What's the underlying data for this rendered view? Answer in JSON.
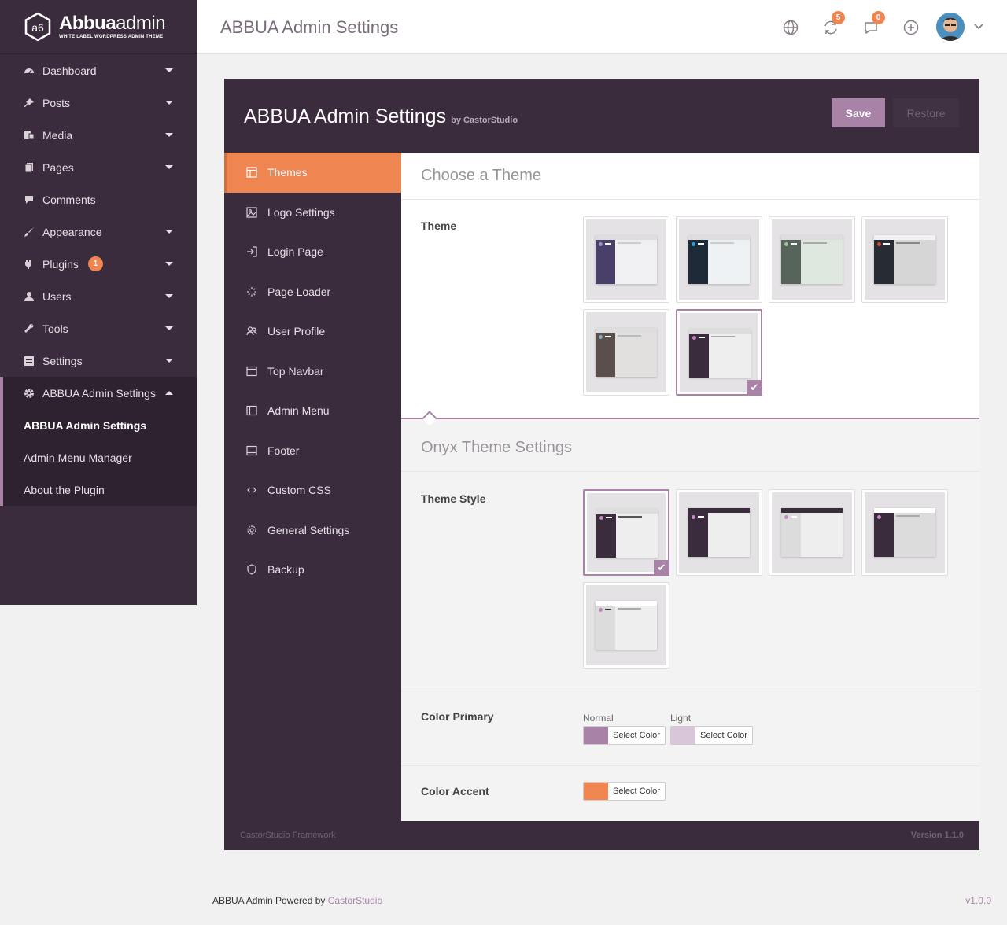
{
  "app": {
    "logo_name_bold": "Abbua",
    "logo_name_light": "admin",
    "logo_tagline": "WHITE LABEL WORDPRESS ADMIN THEME",
    "logo_glyph": "a6"
  },
  "sidebar": {
    "items": [
      {
        "label": "Dashboard",
        "icon": "dashboard-icon"
      },
      {
        "label": "Posts",
        "icon": "pin-icon"
      },
      {
        "label": "Media",
        "icon": "media-icon"
      },
      {
        "label": "Pages",
        "icon": "pages-icon"
      },
      {
        "label": "Comments",
        "icon": "comment-icon"
      },
      {
        "label": "Appearance",
        "icon": "brush-icon"
      },
      {
        "label": "Plugins",
        "icon": "plugin-icon",
        "badge": "1"
      },
      {
        "label": "Users",
        "icon": "user-icon"
      },
      {
        "label": "Tools",
        "icon": "wrench-icon"
      },
      {
        "label": "Settings",
        "icon": "settings-icon"
      },
      {
        "label": "ABBUA Admin Settings",
        "icon": "gear-icon"
      }
    ],
    "submenu": [
      "ABBUA Admin Settings",
      "Admin Menu Manager",
      "About the Plugin"
    ]
  },
  "topbar": {
    "title": "ABBUA Admin Settings",
    "updates_count": "5",
    "comments_count": "0"
  },
  "panel": {
    "title": "ABBUA Admin Settings",
    "by": "by CastorStudio",
    "save_label": "Save",
    "restore_label": "Restore",
    "nav": [
      {
        "label": "Themes",
        "icon": "layout-icon"
      },
      {
        "label": "Logo Settings",
        "icon": "image-icon"
      },
      {
        "label": "Login Page",
        "icon": "login-icon"
      },
      {
        "label": "Page Loader",
        "icon": "spinner-icon"
      },
      {
        "label": "User Profile",
        "icon": "users-icon"
      },
      {
        "label": "Top Navbar",
        "icon": "window-icon"
      },
      {
        "label": "Admin Menu",
        "icon": "sidebar-icon"
      },
      {
        "label": "Footer",
        "icon": "footer-icon"
      },
      {
        "label": "Custom CSS",
        "icon": "code-icon"
      },
      {
        "label": "General Settings",
        "icon": "cog-icon"
      },
      {
        "label": "Backup",
        "icon": "shield-icon"
      }
    ],
    "choose_theme_title": "Choose a Theme",
    "theme_label": "Theme",
    "onyx_title": "Onyx Theme Settings",
    "theme_style_label": "Theme Style",
    "color_primary_label": "Color Primary",
    "normal_caption": "Normal",
    "light_caption": "Light",
    "color_accent_label": "Color Accent",
    "select_color_label": "Select Color",
    "footer_left": "CastorStudio Framework",
    "footer_right": "Version 1.1.0"
  },
  "colors": {
    "primary_normal": "#a982a8",
    "primary_light": "#d9c6d8",
    "accent": "#ef8550"
  },
  "page_footer": {
    "text": "ABBUA Admin Powered by ",
    "link": "CastorStudio",
    "version": "v1.0.0"
  }
}
